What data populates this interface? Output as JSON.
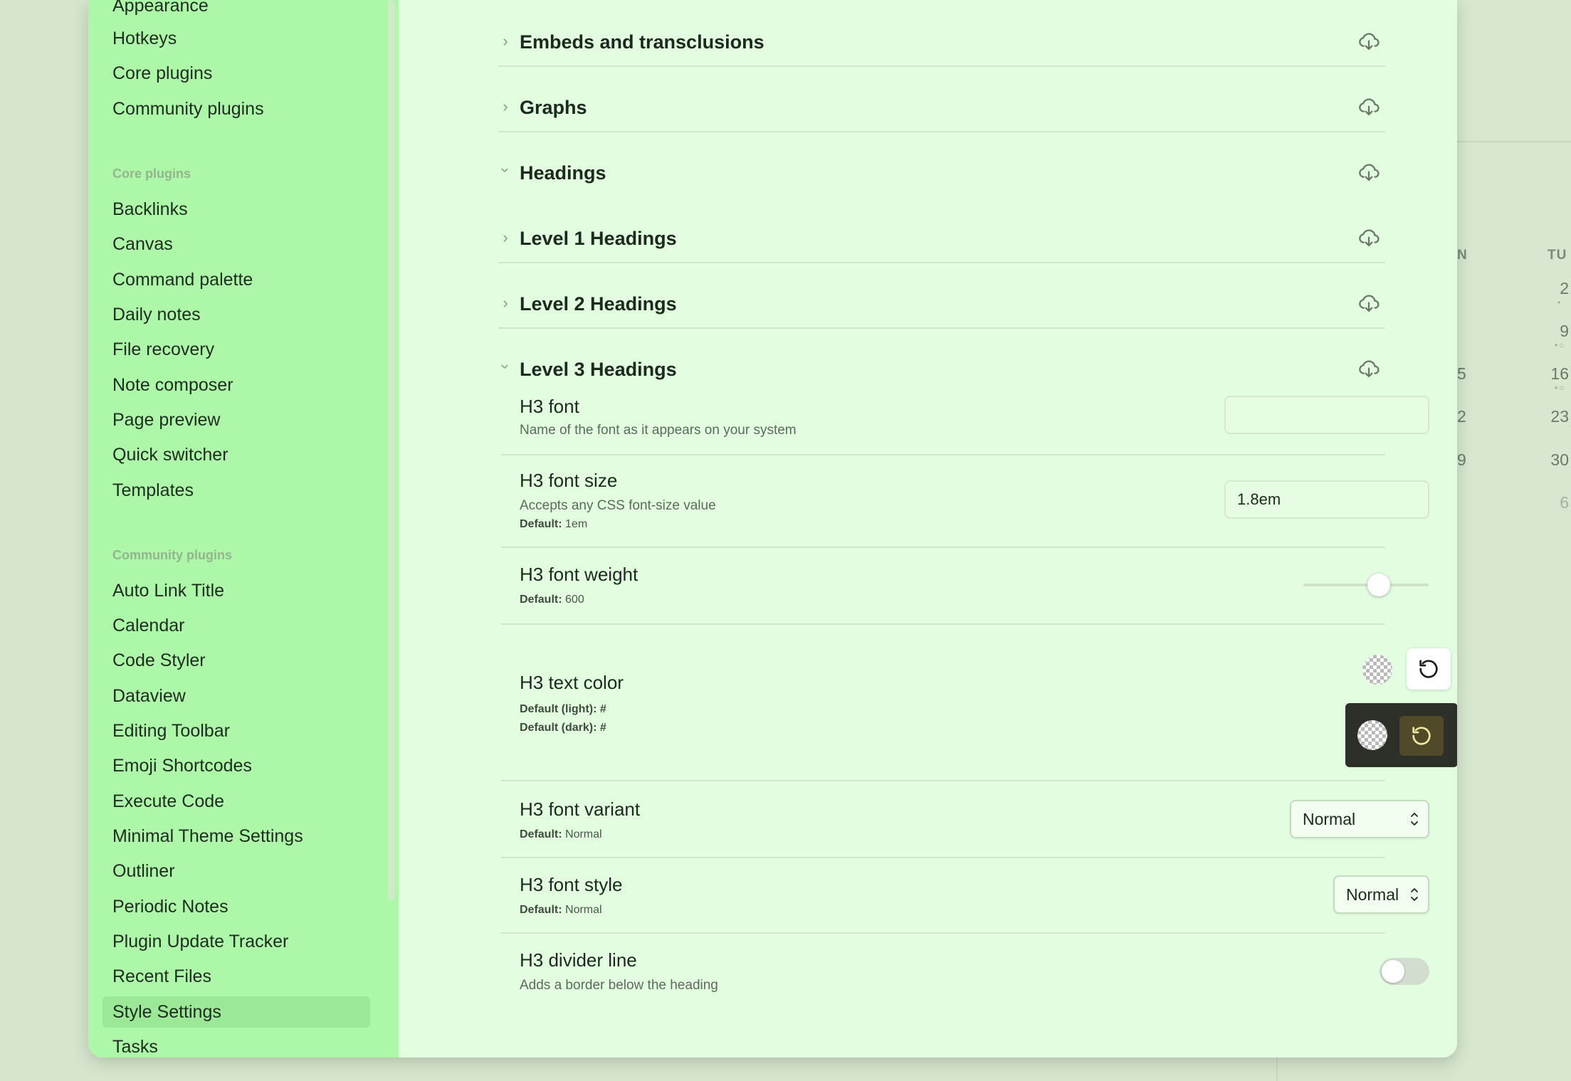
{
  "sidebar": {
    "top_items": [
      "Appearance",
      "Hotkeys",
      "Core plugins",
      "Community plugins"
    ],
    "core_heading": "Core plugins",
    "core_items": [
      "Backlinks",
      "Canvas",
      "Command palette",
      "Daily notes",
      "File recovery",
      "Note composer",
      "Page preview",
      "Quick switcher",
      "Templates"
    ],
    "community_heading": "Community plugins",
    "community_items": [
      "Auto Link Title",
      "Calendar",
      "Code Styler",
      "Dataview",
      "Editing Toolbar",
      "Emoji Shortcodes",
      "Execute Code",
      "Minimal Theme Settings",
      "Outliner",
      "Periodic Notes",
      "Plugin Update Tracker",
      "Recent Files",
      "Style Settings",
      "Tasks"
    ],
    "active_item": "Style Settings"
  },
  "groups": {
    "embeds": "Embeds and transclusions",
    "graphs": "Graphs",
    "headings": "Headings",
    "level1": "Level 1 Headings",
    "level2": "Level 2 Headings",
    "level3": "Level 3 Headings"
  },
  "settings": {
    "h3_font": {
      "name": "H3 font",
      "desc": "Name of the font as it appears on your system",
      "value": ""
    },
    "h3_font_size": {
      "name": "H3 font size",
      "desc": "Accepts any CSS font-size value",
      "default_label": "Default:",
      "default_value": "1em",
      "value": "1.8em"
    },
    "h3_font_weight": {
      "name": "H3 font weight",
      "default_label": "Default:",
      "default_value": "600",
      "slider_fraction": 0.6
    },
    "h3_text_color": {
      "name": "H3 text color",
      "default_light_label": "Default (light):",
      "default_light_value": "#",
      "default_dark_label": "Default (dark):",
      "default_dark_value": "#"
    },
    "h3_font_variant": {
      "name": "H3 font variant",
      "default_label": "Default:",
      "default_value": "Normal",
      "value": "Normal"
    },
    "h3_font_style": {
      "name": "H3 font style",
      "default_label": "Default:",
      "default_value": "Normal",
      "value": "Normal"
    },
    "h3_divider_line": {
      "name": "H3 divider line",
      "desc": "Adds a border below the heading",
      "enabled": false
    }
  },
  "calendar_bg": {
    "headers": [
      "N",
      "TU"
    ],
    "col1": [
      "5",
      "2",
      "9"
    ],
    "col2": [
      "2",
      "9",
      "16",
      "23",
      "30",
      "6"
    ]
  },
  "colors": {
    "sidebar_bg": "#adf8a8",
    "content_bg": "#e2fde0",
    "active_item": "#9be996",
    "dark_panel": "#2d3029",
    "dark_button": "#504a28"
  }
}
